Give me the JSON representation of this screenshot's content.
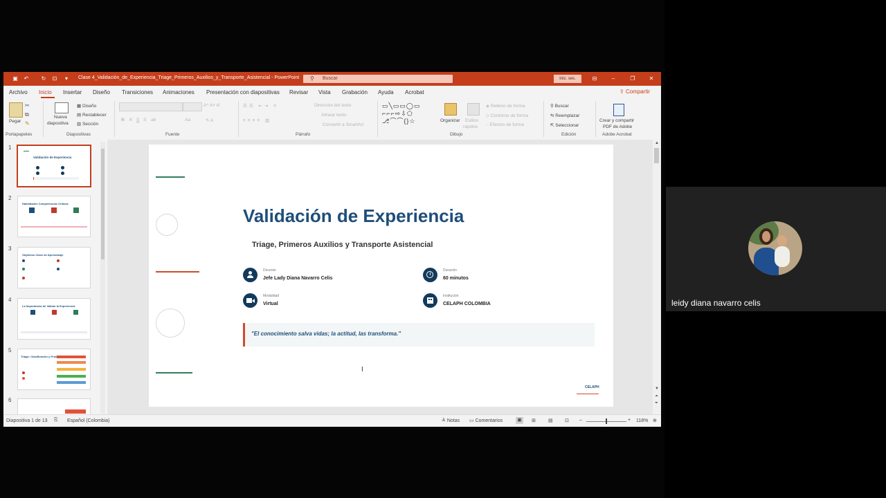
{
  "window": {
    "title": "Clase 4_Validación_de_Experiencia_Triage_Primeros_Auxilios_y_Transporte_Asistencial - PowerPoint",
    "search_placeholder": "Buscar",
    "signin_label": "Inic. ses.",
    "accent_color": "#c43e1c"
  },
  "ribbon_tabs": [
    "Archivo",
    "Inicio",
    "Insertar",
    "Diseño",
    "Transiciones",
    "Animaciones",
    "Presentación con diapositivas",
    "Revisar",
    "Vista",
    "Grabación",
    "Ayuda",
    "Acrobat"
  ],
  "active_tab": "Inicio",
  "share_label": "Compartir",
  "ribbon": {
    "clipboard": {
      "paste": "Pegar",
      "group": "Portapapeles"
    },
    "slides": {
      "new_slide_1": "Nueva",
      "new_slide_2": "diapositiva",
      "layout": "Diseño",
      "reset": "Restablecer",
      "section": "Sección",
      "group": "Diapositivas"
    },
    "font": {
      "group": "Fuente",
      "bold": "N",
      "italic": "K",
      "underline": "S",
      "strike": "S",
      "shadow": "ab",
      "case": "Aa"
    },
    "paragraph": {
      "group": "Párrafo",
      "text_direction": "Dirección del texto",
      "align_text": "Alinear texto",
      "smartart": "Convertir a SmartArt"
    },
    "drawing": {
      "group": "Dibujo",
      "arrange": "Organizar",
      "quick_styles_1": "Estilos",
      "quick_styles_2": "rápidos",
      "fill": "Relleno de forma",
      "outline": "Contorno de forma",
      "effects": "Efectos de forma"
    },
    "editing": {
      "group": "Edición",
      "find": "Buscar",
      "replace": "Reemplazar",
      "select": "Seleccionar"
    },
    "acrobat": {
      "group": "Adobe Acrobat",
      "create_1": "Crear y compartir",
      "create_2": "PDF de Adobe"
    }
  },
  "thumbnails": [
    {
      "num": "1",
      "title": "Validación de Experiencia"
    },
    {
      "num": "2",
      "title": "Habilidades Competencias Críticas"
    },
    {
      "num": "3",
      "title": "Objetivos Clave de Aprendizaje"
    },
    {
      "num": "4",
      "title": "La Importancia de Validar la Experiencia"
    },
    {
      "num": "5",
      "title": "Triage: Clasificación y Priorización"
    },
    {
      "num": "6",
      "title": ""
    }
  ],
  "slide": {
    "title": "Validación de Experiencia",
    "subtitle": "Triage, Primeros Auxilios y Transporte Asistencial",
    "info": [
      {
        "label": "Docente",
        "value": "Jefe Lady Diana Navarro Celis",
        "icon": "person-icon"
      },
      {
        "label": "Duración",
        "value": "60 minutos",
        "icon": "clock-icon"
      },
      {
        "label": "Modalidad",
        "value": "Virtual",
        "icon": "video-camera-icon"
      },
      {
        "label": "Institución",
        "value": "CELAPH COLOMBIA",
        "icon": "building-icon"
      }
    ],
    "quote": "\"El conocimiento salva vidas; la actitud, las transforma.\"",
    "logo": "CELAPH",
    "title_color": "#1f4e79",
    "icon_color": "#123a5c"
  },
  "status": {
    "slide_count": "Diapositiva 1 de 13",
    "language": "Español (Colombia)",
    "notes": "Notas",
    "comments": "Comentarios",
    "zoom": "118%"
  },
  "participant": {
    "name": "leidy diana navarro celis"
  }
}
